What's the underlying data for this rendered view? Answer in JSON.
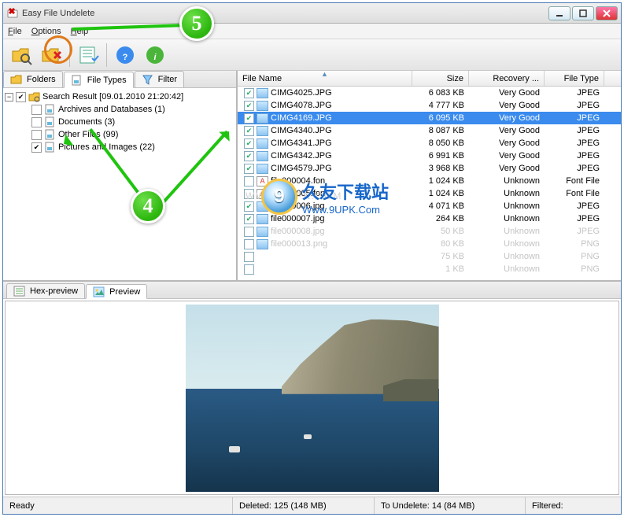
{
  "window": {
    "title": "Easy File Undelete"
  },
  "menu": {
    "file": "File",
    "options": "Options",
    "help": "Help"
  },
  "lefttabs": {
    "folders": "Folders",
    "filetypes": "File Types",
    "filter": "Filter"
  },
  "tree": {
    "root": "Search Result [09.01.2010 21:20:42]",
    "items": [
      {
        "label": "Archives and Databases (1)",
        "checked": false
      },
      {
        "label": "Documents (3)",
        "checked": false
      },
      {
        "label": "Other Files (99)",
        "checked": false
      },
      {
        "label": "Pictures and Images (22)",
        "checked": true
      }
    ]
  },
  "columns": {
    "name": "File Name",
    "size": "Size",
    "recovery": "Recovery ...",
    "type": "File Type"
  },
  "colw": {
    "name": 222,
    "size": 72,
    "recovery": 96,
    "type": 76
  },
  "files": [
    {
      "chk": true,
      "ico": "img",
      "name": "CIMG4025.JPG",
      "size": "6 083 KB",
      "rec": "Very Good",
      "type": "JPEG"
    },
    {
      "chk": true,
      "ico": "img",
      "name": "CIMG4078.JPG",
      "size": "4 777 KB",
      "rec": "Very Good",
      "type": "JPEG"
    },
    {
      "chk": true,
      "ico": "img",
      "name": "CIMG4169.JPG",
      "size": "6 095 KB",
      "rec": "Very Good",
      "type": "JPEG",
      "selected": true
    },
    {
      "chk": true,
      "ico": "img",
      "name": "CIMG4340.JPG",
      "size": "8 087 KB",
      "rec": "Very Good",
      "type": "JPEG"
    },
    {
      "chk": true,
      "ico": "img",
      "name": "CIMG4341.JPG",
      "size": "8 050 KB",
      "rec": "Very Good",
      "type": "JPEG"
    },
    {
      "chk": true,
      "ico": "img",
      "name": "CIMG4342.JPG",
      "size": "6 991 KB",
      "rec": "Very Good",
      "type": "JPEG"
    },
    {
      "chk": true,
      "ico": "img",
      "name": "CIMG4579.JPG",
      "size": "3 968 KB",
      "rec": "Very Good",
      "type": "JPEG"
    },
    {
      "chk": false,
      "ico": "font",
      "name": "file000004.fon",
      "size": "1 024 KB",
      "rec": "Unknown",
      "type": "Font File"
    },
    {
      "chk": false,
      "ico": "font",
      "name": "file000005.fon",
      "size": "1 024 KB",
      "rec": "Unknown",
      "type": "Font File"
    },
    {
      "chk": true,
      "ico": "img",
      "name": "file000006.jpg",
      "size": "4 071 KB",
      "rec": "Unknown",
      "type": "JPEG"
    },
    {
      "chk": true,
      "ico": "img",
      "name": "file000007.jpg",
      "size": "264 KB",
      "rec": "Unknown",
      "type": "JPEG"
    },
    {
      "chk": false,
      "ico": "img",
      "name": "file000008.jpg",
      "size": "50 KB",
      "rec": "Unknown",
      "type": "JPEG",
      "dim": true
    },
    {
      "chk": false,
      "ico": "img",
      "name": "file000013.png",
      "size": "80 KB",
      "rec": "Unknown",
      "type": "PNG",
      "dim": true
    },
    {
      "chk": false,
      "ico": "",
      "name": "",
      "size": "75 KB",
      "rec": "Unknown",
      "type": "PNG",
      "dim": true
    },
    {
      "chk": false,
      "ico": "",
      "name": "",
      "size": "1 KB",
      "rec": "Unknown",
      "type": "PNG",
      "dim": true
    }
  ],
  "btabs": {
    "hex": "Hex-preview",
    "preview": "Preview"
  },
  "status": {
    "ready": "Ready",
    "deleted": "Deleted: 125 (148 MB)",
    "undelete": "To Undelete: 14 (84 MB)",
    "filtered": "Filtered:"
  },
  "callouts": {
    "step4": "4",
    "step5": "5"
  },
  "watermark": "WWW.9UPK.COM",
  "logo": {
    "glyph": "9",
    "line1": "久友下载站",
    "line2": "Www.9UPK.Com"
  }
}
